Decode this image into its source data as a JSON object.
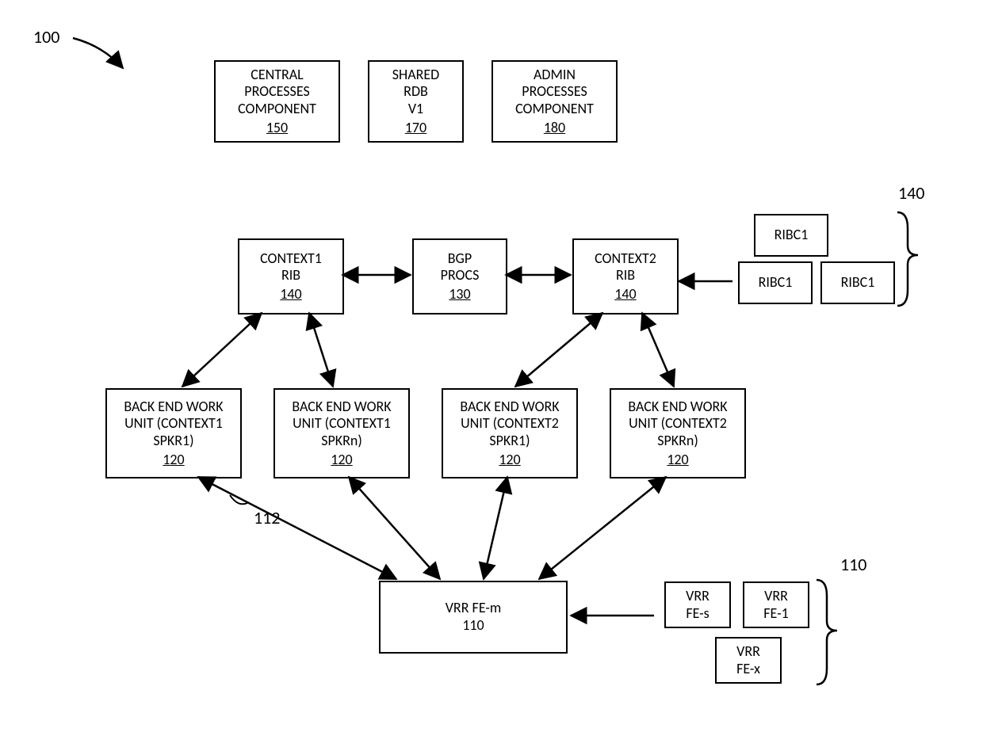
{
  "diagram_label": "100",
  "top_row": {
    "central": {
      "l1": "CENTRAL",
      "l2": "PROCESSES",
      "l3": "COMPONENT",
      "ref": "150"
    },
    "shared": {
      "l1": "SHARED",
      "l2": "RDB",
      "l3": "V1",
      "ref": "170"
    },
    "admin": {
      "l1": "ADMIN",
      "l2": "PROCESSES",
      "l3": "COMPONENT",
      "ref": "180"
    }
  },
  "mid_row": {
    "ctx1": {
      "l1": "CONTEXT1",
      "l2": "RIB",
      "ref": "140"
    },
    "bgp": {
      "l1": "BGP",
      "l2": "PROCS",
      "ref": "130"
    },
    "ctx2": {
      "l1": "CONTEXT2",
      "l2": "RIB",
      "ref": "140"
    },
    "ribc_group_label": "140",
    "ribc_a": "RIBC1",
    "ribc_b": "RIBC1",
    "ribc_c": "RIBC1"
  },
  "back_row": {
    "b1": {
      "l1": "BACK END WORK",
      "l2": "UNIT (CONTEXT1",
      "l3": "SPKR1)",
      "ref": "120"
    },
    "b2": {
      "l1": "BACK END WORK",
      "l2": "UNIT (CONTEXT1",
      "l3": "SPKRn)",
      "ref": "120"
    },
    "b3": {
      "l1": "BACK END WORK",
      "l2": "UNIT (CONTEXT2",
      "l3": "SPKR1)",
      "ref": "120"
    },
    "b4": {
      "l1": "BACK END WORK",
      "l2": "UNIT (CONTEXT2",
      "l3": "SPKRn)",
      "ref": "120"
    },
    "connector_label": "112"
  },
  "bottom": {
    "main": {
      "l1": "VRR FE-m",
      "ref": "110"
    },
    "group_label": "110",
    "s": {
      "l1": "VRR",
      "l2": "FE-s"
    },
    "n1": {
      "l1": "VRR",
      "l2": "FE-1"
    },
    "x": {
      "l1": "VRR",
      "l2": "FE-x"
    }
  }
}
